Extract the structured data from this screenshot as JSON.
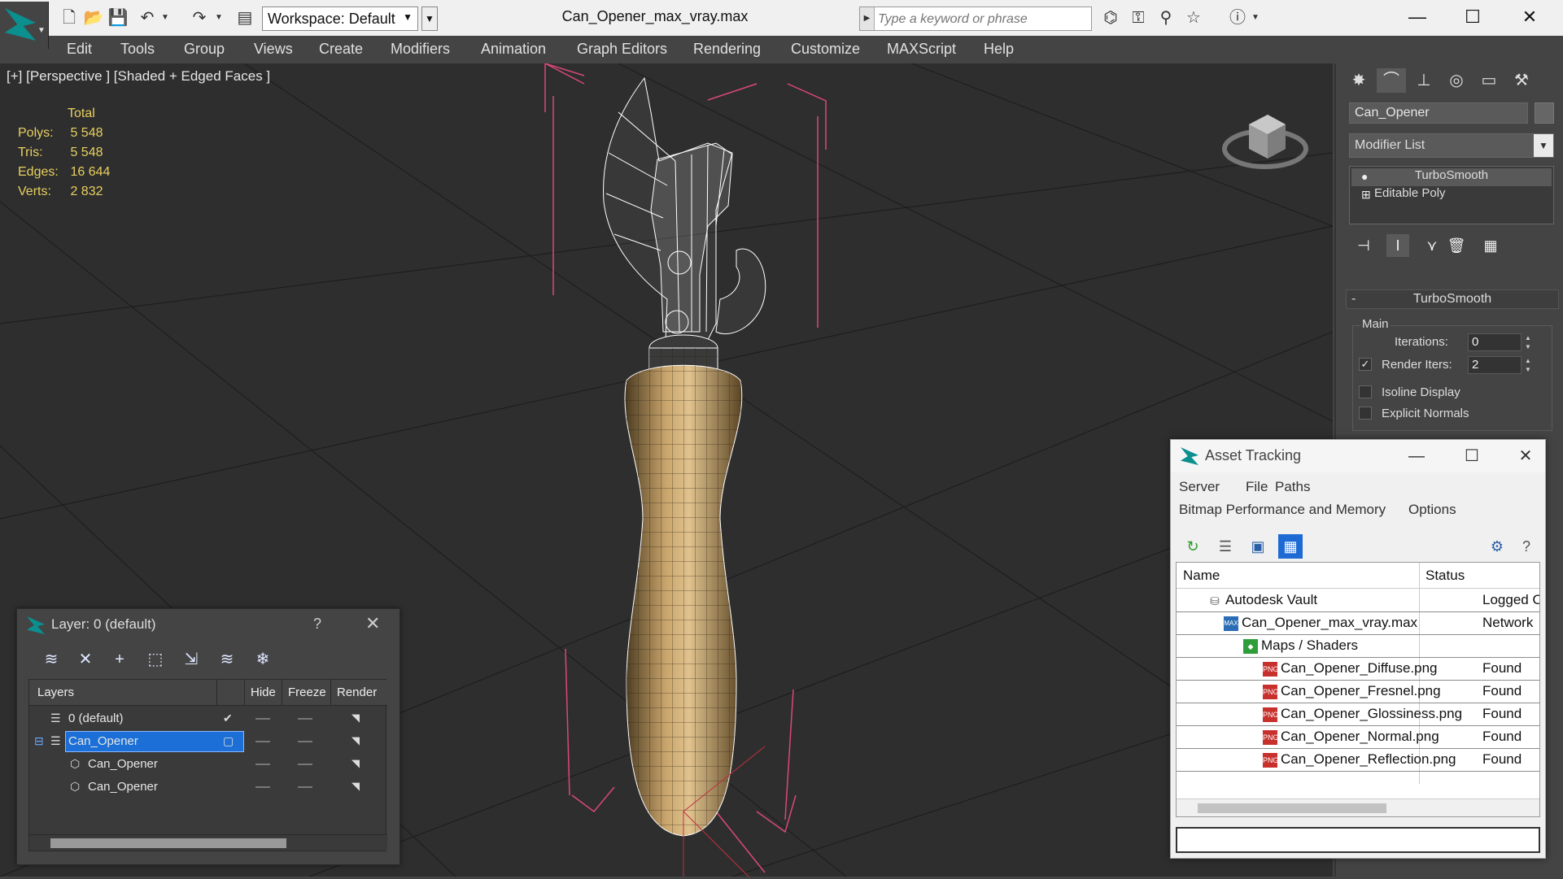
{
  "titlebar": {
    "workspace_label": "Workspace: Default",
    "file_title": "Can_Opener_max_vray.max",
    "search_placeholder": "Type a keyword or phrase"
  },
  "menu": [
    "Edit",
    "Tools",
    "Group",
    "Views",
    "Create",
    "Modifiers",
    "Animation",
    "Graph Editors",
    "Rendering",
    "Customize",
    "MAXScript",
    "Help"
  ],
  "viewport": {
    "label": "[+] [Perspective ] [Shaded + Edged Faces ]",
    "stats": {
      "total_label": "Total",
      "rows": [
        {
          "key": "Polys:",
          "value": "5 548"
        },
        {
          "key": "Tris:",
          "value": "5 548"
        },
        {
          "key": "Edges:",
          "value": "16 644"
        },
        {
          "key": "Verts:",
          "value": "2 832"
        }
      ]
    }
  },
  "command_panel": {
    "object_name": "Can_Opener",
    "modifier_list_label": "Modifier List",
    "stack": [
      "TurboSmooth",
      "Editable Poly"
    ],
    "rollout_title": "TurboSmooth",
    "group_main": "Main",
    "iterations_label": "Iterations:",
    "iterations_value": "0",
    "render_iters_label": "Render Iters:",
    "render_iters_value": "2",
    "render_iters_checked": true,
    "isoline_label": "Isoline Display",
    "explicit_normals_label": "Explicit Normals"
  },
  "layer_dialog": {
    "title": "Layer: 0 (default)",
    "help": "?",
    "columns": {
      "layers": "Layers",
      "hide": "Hide",
      "freeze": "Freeze",
      "render": "Render"
    },
    "rows": [
      {
        "name": "0 (default)",
        "level": 0,
        "current": true,
        "selected": false
      },
      {
        "name": "Can_Opener",
        "level": 0,
        "current": false,
        "selected": true
      },
      {
        "name": "Can_Opener",
        "level": 1,
        "current": false,
        "selected": false
      },
      {
        "name": "Can_Opener",
        "level": 1,
        "current": false,
        "selected": false
      }
    ]
  },
  "asset_dialog": {
    "title": "Asset Tracking",
    "menu_row1": [
      "Server",
      "File",
      "Paths"
    ],
    "menu_row2": [
      "Bitmap Performance and Memory",
      "Options"
    ],
    "columns": {
      "name": "Name",
      "status": "Status"
    },
    "rows": [
      {
        "name": "Autodesk Vault",
        "status": "Logged O",
        "indent": 1,
        "icon": "vault-icon"
      },
      {
        "name": "Can_Opener_max_vray.max",
        "status": "Network",
        "indent": 2,
        "icon": "max-file-icon"
      },
      {
        "name": "Maps / Shaders",
        "status": "",
        "indent": 3,
        "icon": "maps-icon"
      },
      {
        "name": "Can_Opener_Diffuse.png",
        "status": "Found",
        "indent": 4,
        "icon": "png-icon"
      },
      {
        "name": "Can_Opener_Fresnel.png",
        "status": "Found",
        "indent": 4,
        "icon": "png-icon"
      },
      {
        "name": "Can_Opener_Glossiness.png",
        "status": "Found",
        "indent": 4,
        "icon": "png-icon"
      },
      {
        "name": "Can_Opener_Normal.png",
        "status": "Found",
        "indent": 4,
        "icon": "png-icon"
      },
      {
        "name": "Can_Opener_Reflection.png",
        "status": "Found",
        "indent": 4,
        "icon": "png-icon"
      }
    ]
  },
  "colors": {
    "accent_teal": "#0b8f8f",
    "stats_yellow": "#e8d060",
    "selection_blue": "#1b6fd6",
    "bounding_box_pink": "#d9487a"
  }
}
